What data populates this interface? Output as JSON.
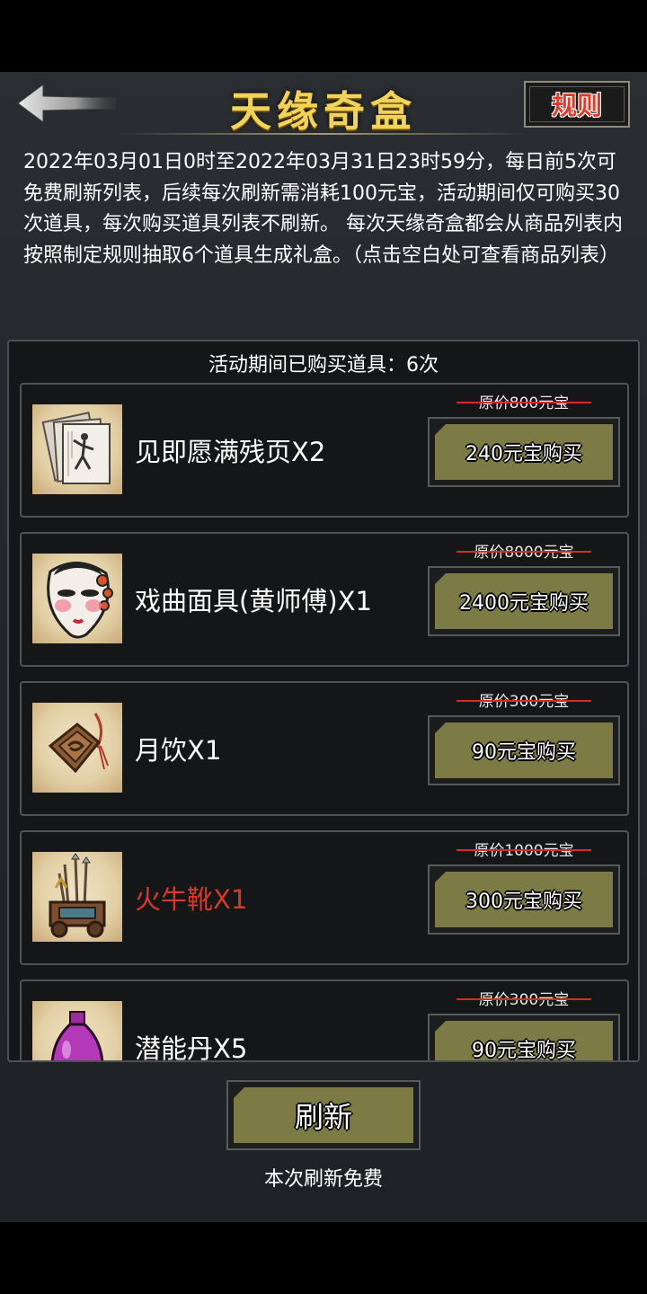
{
  "header": {
    "title": "天缘奇盒",
    "rules_label": "规则",
    "back_icon": "back-arrow-icon"
  },
  "description": "2022年03月01日0时至2022年03月31日23时59分，每日前5次可免费刷新列表，后续每次刷新需消耗100元宝，活动期间仅可购买30次道具，每次购买道具列表不刷新。 每次天缘奇盒都会从商品列表内按照制定规则抽取6个道具生成礼盒。（点击空白处可查看商品列表）",
  "panel": {
    "purchased_text": "活动期间已购买道具：6次",
    "items": [
      {
        "name": "见即愿满残页X2",
        "original_price": "原价800元宝",
        "buy_label": "240元宝购买",
        "icon": "manuscript-pages-icon"
      },
      {
        "name": "戏曲面具(黄师傅)X1",
        "original_price": "原价8000元宝",
        "buy_label": "2400元宝购买",
        "icon": "opera-mask-icon"
      },
      {
        "name": "月饮X1",
        "original_price": "原价300元宝",
        "buy_label": "90元宝购买",
        "icon": "jade-pendant-icon"
      },
      {
        "name": "火牛靴X1",
        "original_price": "原价1000元宝",
        "buy_label": "300元宝购买",
        "icon": "weapon-cart-icon",
        "name_color": "#d63a2c"
      },
      {
        "name": "潜能丹X5",
        "original_price": "原价300元宝",
        "buy_label": "90元宝购买",
        "icon": "purple-vase-icon"
      }
    ]
  },
  "footer": {
    "refresh_label": "刷新",
    "refresh_note": "本次刷新免费"
  },
  "colors": {
    "title_gold": "#f1d25a",
    "button_olive": "#7d7b45",
    "strike_red": "#d82a22",
    "rules_red": "#e13a2a"
  }
}
